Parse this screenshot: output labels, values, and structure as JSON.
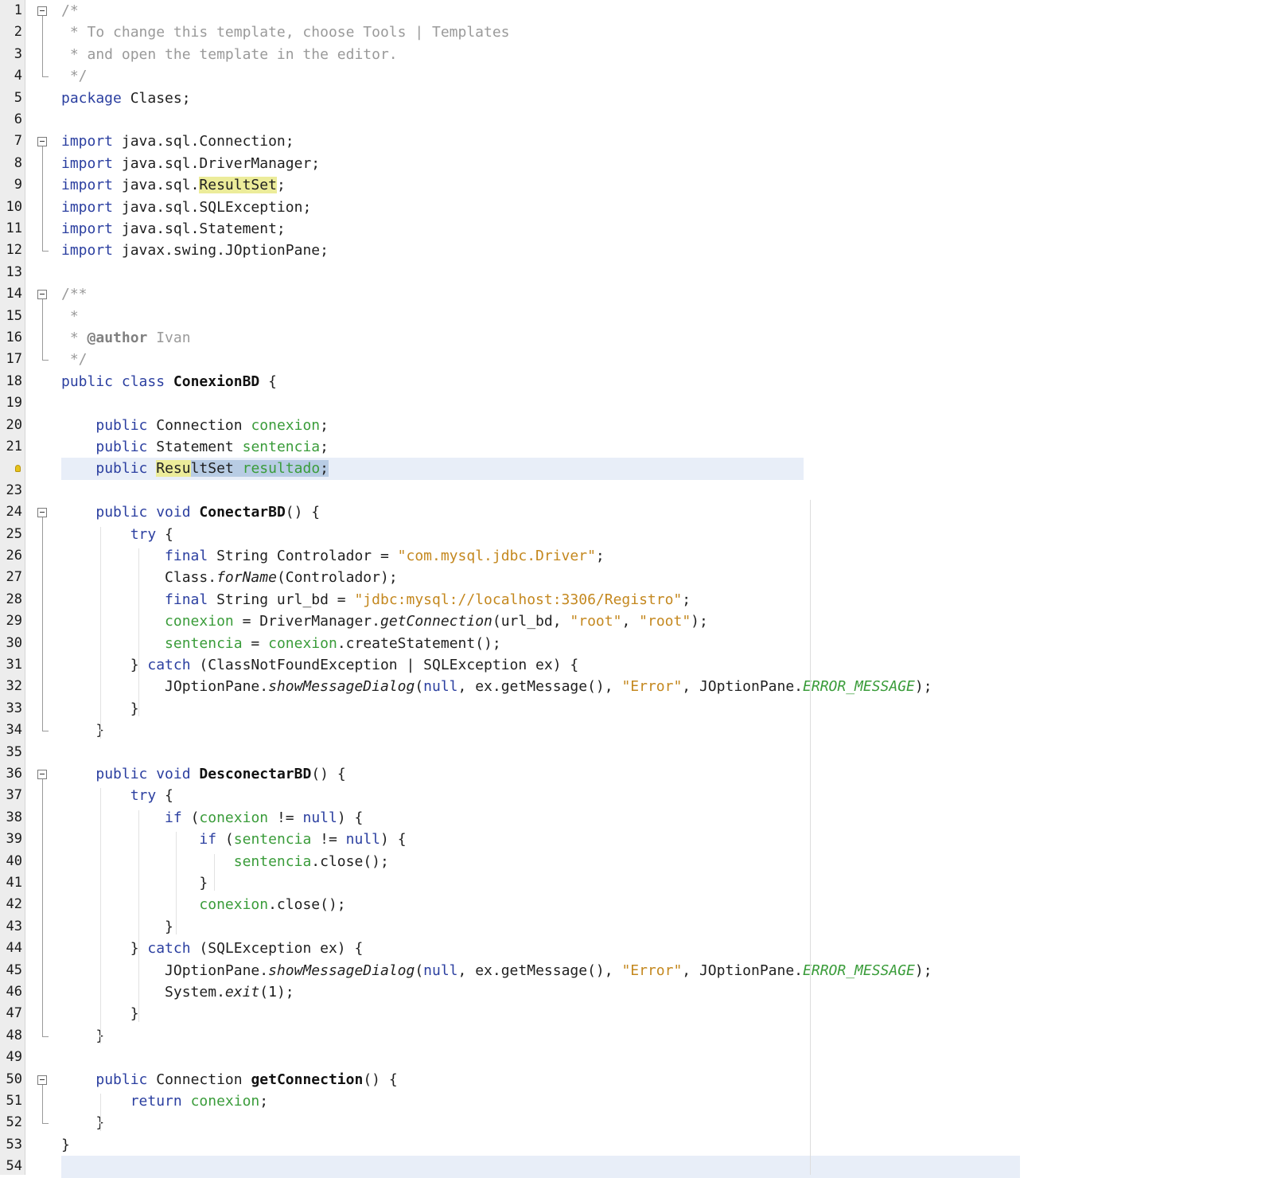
{
  "editor": {
    "lines": [
      {
        "n": "1",
        "tokens": [
          {
            "t": "/*",
            "c": "cm"
          }
        ]
      },
      {
        "n": "2",
        "tokens": [
          {
            "t": " * To change this template, choose Tools | Templates",
            "c": "cm"
          }
        ]
      },
      {
        "n": "3",
        "tokens": [
          {
            "t": " * and open the template in the editor.",
            "c": "cm"
          }
        ]
      },
      {
        "n": "4",
        "tokens": [
          {
            "t": " */",
            "c": "cm"
          }
        ]
      },
      {
        "n": "5",
        "tokens": [
          {
            "t": "package",
            "c": "kw"
          },
          {
            "t": " Clases;"
          }
        ]
      },
      {
        "n": "6",
        "tokens": []
      },
      {
        "n": "7",
        "tokens": [
          {
            "t": "import",
            "c": "kw"
          },
          {
            "t": " java.sql.Connection;"
          }
        ]
      },
      {
        "n": "8",
        "tokens": [
          {
            "t": "import",
            "c": "kw"
          },
          {
            "t": " java.sql.DriverManager;"
          }
        ]
      },
      {
        "n": "9",
        "tokens": [
          {
            "t": "import",
            "c": "kw"
          },
          {
            "t": " java.sql."
          },
          {
            "t": "ResultSet",
            "c": "hl"
          },
          {
            "t": ";"
          }
        ]
      },
      {
        "n": "10",
        "tokens": [
          {
            "t": "import",
            "c": "kw"
          },
          {
            "t": " java.sql.SQLException;"
          }
        ]
      },
      {
        "n": "11",
        "tokens": [
          {
            "t": "import",
            "c": "kw"
          },
          {
            "t": " java.sql.Statement;"
          }
        ]
      },
      {
        "n": "12",
        "tokens": [
          {
            "t": "import",
            "c": "kw"
          },
          {
            "t": " javax.swing.JOptionPane;"
          }
        ]
      },
      {
        "n": "13",
        "tokens": []
      },
      {
        "n": "14",
        "tokens": [
          {
            "t": "/**",
            "c": "cm"
          }
        ]
      },
      {
        "n": "15",
        "tokens": [
          {
            "t": " *",
            "c": "cm"
          }
        ]
      },
      {
        "n": "16",
        "tokens": [
          {
            "t": " * ",
            "c": "cm"
          },
          {
            "t": "@author",
            "c": "cmb"
          },
          {
            "t": " Ivan",
            "c": "cm"
          }
        ]
      },
      {
        "n": "17",
        "tokens": [
          {
            "t": " */",
            "c": "cm"
          }
        ]
      },
      {
        "n": "18",
        "tokens": [
          {
            "t": "public class",
            "c": "kw"
          },
          {
            "t": " "
          },
          {
            "t": "ConexionBD",
            "c": "dn"
          },
          {
            "t": " {"
          }
        ]
      },
      {
        "n": "19",
        "tokens": []
      },
      {
        "n": "20",
        "tokens": [
          {
            "t": "    "
          },
          {
            "t": "public",
            "c": "kw"
          },
          {
            "t": " Connection "
          },
          {
            "t": "conexion",
            "c": "fd"
          },
          {
            "t": ";"
          }
        ]
      },
      {
        "n": "21",
        "tokens": [
          {
            "t": "    "
          },
          {
            "t": "public",
            "c": "kw"
          },
          {
            "t": " Statement "
          },
          {
            "t": "sentencia",
            "c": "fd"
          },
          {
            "t": ";"
          }
        ]
      },
      {
        "n": "",
        "tokens": [
          {
            "t": "    "
          },
          {
            "t": "public",
            "c": "kw"
          },
          {
            "t": " "
          },
          {
            "t": "Resu",
            "c": "hl"
          },
          {
            "t": "ltSet ",
            "c": "sel"
          },
          {
            "t": "resultado",
            "c": "fd sel"
          },
          {
            "t": ";",
            "c": "sel"
          }
        ]
      },
      {
        "n": "23",
        "tokens": []
      },
      {
        "n": "24",
        "tokens": [
          {
            "t": "    "
          },
          {
            "t": "public void",
            "c": "kw"
          },
          {
            "t": " "
          },
          {
            "t": "ConectarBD",
            "c": "dn"
          },
          {
            "t": "() {"
          }
        ]
      },
      {
        "n": "25",
        "tokens": [
          {
            "t": "        "
          },
          {
            "t": "try",
            "c": "kw"
          },
          {
            "t": " {"
          }
        ]
      },
      {
        "n": "26",
        "tokens": [
          {
            "t": "            "
          },
          {
            "t": "final",
            "c": "kw"
          },
          {
            "t": " String Controlador = "
          },
          {
            "t": "\"com.mysql.jdbc.Driver\"",
            "c": "st"
          },
          {
            "t": ";"
          }
        ]
      },
      {
        "n": "27",
        "tokens": [
          {
            "t": "            Class."
          },
          {
            "t": "forName",
            "c": "sm"
          },
          {
            "t": "(Controlador);"
          }
        ]
      },
      {
        "n": "28",
        "tokens": [
          {
            "t": "            "
          },
          {
            "t": "final",
            "c": "kw"
          },
          {
            "t": " String url_bd = "
          },
          {
            "t": "\"jdbc:mysql://localhost:3306/Registro\"",
            "c": "st"
          },
          {
            "t": ";"
          }
        ]
      },
      {
        "n": "29",
        "tokens": [
          {
            "t": "            "
          },
          {
            "t": "conexion",
            "c": "fd"
          },
          {
            "t": " = DriverManager."
          },
          {
            "t": "getConnection",
            "c": "sm"
          },
          {
            "t": "(url_bd, "
          },
          {
            "t": "\"root\"",
            "c": "st"
          },
          {
            "t": ", "
          },
          {
            "t": "\"root\"",
            "c": "st"
          },
          {
            "t": ");"
          }
        ]
      },
      {
        "n": "30",
        "tokens": [
          {
            "t": "            "
          },
          {
            "t": "sentencia",
            "c": "fd"
          },
          {
            "t": " = "
          },
          {
            "t": "conexion",
            "c": "fd"
          },
          {
            "t": ".createStatement();"
          }
        ]
      },
      {
        "n": "31",
        "tokens": [
          {
            "t": "        } "
          },
          {
            "t": "catch",
            "c": "kw"
          },
          {
            "t": " (ClassNotFoundException | SQLException ex) {"
          }
        ]
      },
      {
        "n": "32",
        "tokens": [
          {
            "t": "            JOptionPane."
          },
          {
            "t": "showMessageDialog",
            "c": "sm"
          },
          {
            "t": "("
          },
          {
            "t": "null",
            "c": "kw"
          },
          {
            "t": ", ex.getMessage(), "
          },
          {
            "t": "\"Error\"",
            "c": "st"
          },
          {
            "t": ", JOptionPane."
          },
          {
            "t": "ERROR_MESSAGE",
            "c": "sfd"
          },
          {
            "t": ");"
          }
        ]
      },
      {
        "n": "33",
        "tokens": [
          {
            "t": "        }"
          }
        ]
      },
      {
        "n": "34",
        "tokens": [
          {
            "t": "    }"
          }
        ]
      },
      {
        "n": "35",
        "tokens": []
      },
      {
        "n": "36",
        "tokens": [
          {
            "t": "    "
          },
          {
            "t": "public void",
            "c": "kw"
          },
          {
            "t": " "
          },
          {
            "t": "DesconectarBD",
            "c": "dn"
          },
          {
            "t": "() {"
          }
        ]
      },
      {
        "n": "37",
        "tokens": [
          {
            "t": "        "
          },
          {
            "t": "try",
            "c": "kw"
          },
          {
            "t": " {"
          }
        ]
      },
      {
        "n": "38",
        "tokens": [
          {
            "t": "            "
          },
          {
            "t": "if",
            "c": "kw"
          },
          {
            "t": " ("
          },
          {
            "t": "conexion",
            "c": "fd"
          },
          {
            "t": " != "
          },
          {
            "t": "null",
            "c": "kw"
          },
          {
            "t": ") {"
          }
        ]
      },
      {
        "n": "39",
        "tokens": [
          {
            "t": "                "
          },
          {
            "t": "if",
            "c": "kw"
          },
          {
            "t": " ("
          },
          {
            "t": "sentencia",
            "c": "fd"
          },
          {
            "t": " != "
          },
          {
            "t": "null",
            "c": "kw"
          },
          {
            "t": ") {"
          }
        ]
      },
      {
        "n": "40",
        "tokens": [
          {
            "t": "                    "
          },
          {
            "t": "sentencia",
            "c": "fd"
          },
          {
            "t": ".close();"
          }
        ]
      },
      {
        "n": "41",
        "tokens": [
          {
            "t": "                }"
          }
        ]
      },
      {
        "n": "42",
        "tokens": [
          {
            "t": "                "
          },
          {
            "t": "conexion",
            "c": "fd"
          },
          {
            "t": ".close();"
          }
        ]
      },
      {
        "n": "43",
        "tokens": [
          {
            "t": "            }"
          }
        ]
      },
      {
        "n": "44",
        "tokens": [
          {
            "t": "        } "
          },
          {
            "t": "catch",
            "c": "kw"
          },
          {
            "t": " (SQLException ex) {"
          }
        ]
      },
      {
        "n": "45",
        "tokens": [
          {
            "t": "            JOptionPane."
          },
          {
            "t": "showMessageDialog",
            "c": "sm"
          },
          {
            "t": "("
          },
          {
            "t": "null",
            "c": "kw"
          },
          {
            "t": ", ex.getMessage(), "
          },
          {
            "t": "\"Error\"",
            "c": "st"
          },
          {
            "t": ", JOptionPane."
          },
          {
            "t": "ERROR_MESSAGE",
            "c": "sfd"
          },
          {
            "t": ");"
          }
        ]
      },
      {
        "n": "46",
        "tokens": [
          {
            "t": "            System."
          },
          {
            "t": "exit",
            "c": "sm"
          },
          {
            "t": "(1);"
          }
        ]
      },
      {
        "n": "47",
        "tokens": [
          {
            "t": "        }"
          }
        ]
      },
      {
        "n": "48",
        "tokens": [
          {
            "t": "    }"
          }
        ]
      },
      {
        "n": "49",
        "tokens": []
      },
      {
        "n": "50",
        "tokens": [
          {
            "t": "    "
          },
          {
            "t": "public",
            "c": "kw"
          },
          {
            "t": " Connection "
          },
          {
            "t": "getConnection",
            "c": "dn"
          },
          {
            "t": "() {"
          }
        ]
      },
      {
        "n": "51",
        "tokens": [
          {
            "t": "        "
          },
          {
            "t": "return",
            "c": "kw"
          },
          {
            "t": " "
          },
          {
            "t": "conexion",
            "c": "fd"
          },
          {
            "t": ";"
          }
        ]
      },
      {
        "n": "52",
        "tokens": [
          {
            "t": "    }"
          }
        ]
      },
      {
        "n": "53",
        "tokens": [
          {
            "t": "}"
          }
        ]
      },
      {
        "n": "54",
        "tokens": []
      }
    ]
  },
  "icons": {
    "fold": "fold-collapse-icon",
    "hint": "lightbulb-icon"
  },
  "colors": {
    "keyword": "#2b3fa0",
    "comment": "#9a9a9a",
    "string": "#c4881f",
    "field": "#3a9c3a",
    "current_line": "#e8eef8",
    "occurrence": "#ecec9a",
    "selection": "#b8cce4"
  }
}
